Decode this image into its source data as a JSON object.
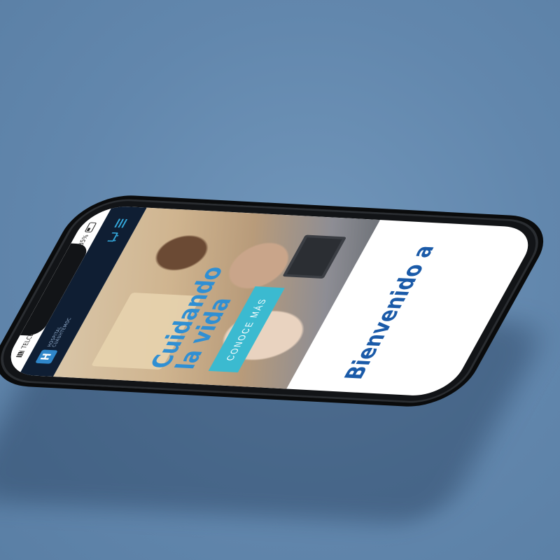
{
  "status_bar": {
    "carrier": "TELCEL",
    "battery": "35%"
  },
  "navbar": {
    "logo_letter": "H",
    "logo_text": "HOSPITAL CUAUHTEMOC",
    "cart_icon": "cart-icon",
    "menu_icon": "hamburger-menu-icon"
  },
  "hero": {
    "title": "Cuidando la vida",
    "cta_label": "CONOCE MÁS"
  },
  "content": {
    "welcome_heading": "Bienvenido a"
  },
  "colors": {
    "background": "#6a8fb2",
    "navbar": "#0f1e33",
    "accent": "#2f8fd3",
    "cta": "#3bbad0",
    "heading": "#1a5aa8"
  }
}
